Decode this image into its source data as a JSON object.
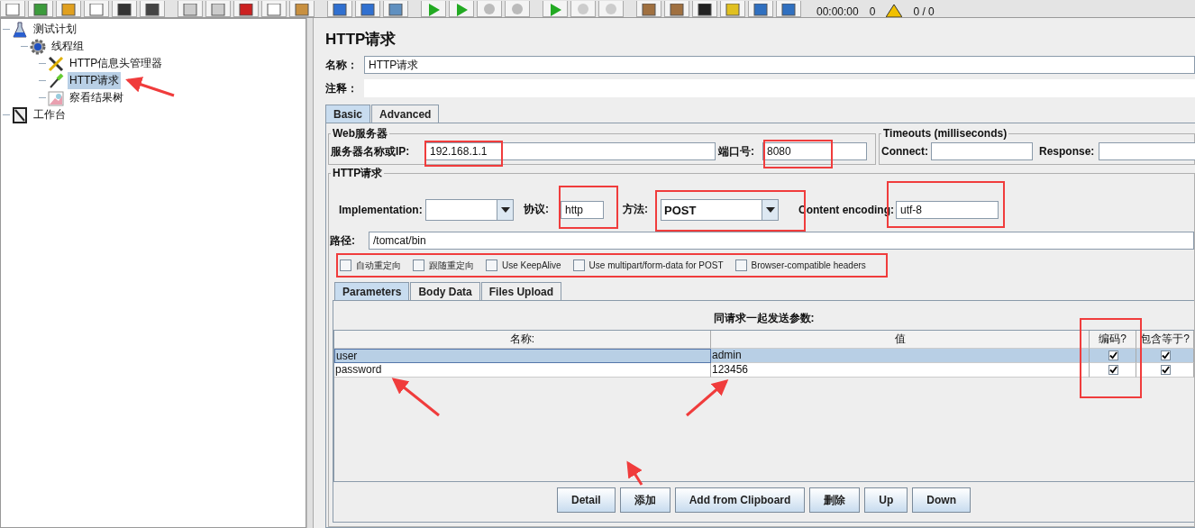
{
  "toolbar": {
    "elapsed": "00:00:00",
    "warnings": "0",
    "threads": "0 / 0"
  },
  "tree": [
    {
      "label": "测试计划",
      "kind": "plan",
      "selected": false,
      "children": [
        {
          "label": "线程组",
          "kind": "threads",
          "selected": false,
          "children": [
            {
              "label": "HTTP信息头管理器",
              "kind": "config",
              "selected": false
            },
            {
              "label": "HTTP请求",
              "kind": "sampler",
              "selected": true
            },
            {
              "label": "察看结果树",
              "kind": "listener",
              "selected": false
            }
          ]
        }
      ]
    },
    {
      "label": "工作台",
      "kind": "workbench",
      "selected": false
    }
  ],
  "panel": {
    "title": "HTTP请求",
    "name_label": "名称：",
    "name_value": "HTTP请求",
    "comment_label": "注释：",
    "tabs": [
      {
        "label": "Basic",
        "selected": true
      },
      {
        "label": "Advanced",
        "selected": false
      }
    ],
    "web_server": {
      "title": "Web服务器",
      "server_label": "服务器名称或IP:",
      "server_value": "192.168.1.1",
      "port_label": "端口号:",
      "port_value": "8080"
    },
    "timeouts": {
      "title": "Timeouts (milliseconds)",
      "connect_label": "Connect:",
      "response_label": "Response:"
    },
    "http": {
      "title": "HTTP请求",
      "implementation_label": "Implementation:",
      "protocol_label": "协议:",
      "protocol_value": "http",
      "method_label": "方法:",
      "method_value": "POST",
      "encoding_label": "Content encoding:",
      "encoding_value": "utf-8",
      "path_label": "路径:",
      "path_value": "/tomcat/bin"
    },
    "options": [
      {
        "label": "自动重定向",
        "checked": false
      },
      {
        "label": "跟随重定向",
        "checked": false
      },
      {
        "label": "Use KeepAlive",
        "checked": false
      },
      {
        "label": "Use multipart/form-data for POST",
        "checked": false
      },
      {
        "label": "Browser-compatible headers",
        "checked": false
      }
    ],
    "sub_tabs": [
      {
        "label": "Parameters",
        "selected": true
      },
      {
        "label": "Body Data",
        "selected": false
      },
      {
        "label": "Files Upload",
        "selected": false
      }
    ],
    "table": {
      "caption": "同请求一起发送参数:",
      "columns": [
        "名称:",
        "值",
        "编码?",
        "包含等于?"
      ],
      "rows": [
        {
          "name": "user",
          "value": "admin",
          "encode": true,
          "include_equals": true,
          "selected": true
        },
        {
          "name": "password",
          "value": "123456",
          "encode": true,
          "include_equals": true,
          "selected": false
        }
      ]
    },
    "buttons": [
      "Detail",
      "添加",
      "Add from Clipboard",
      "删除",
      "Up",
      "Down"
    ]
  }
}
